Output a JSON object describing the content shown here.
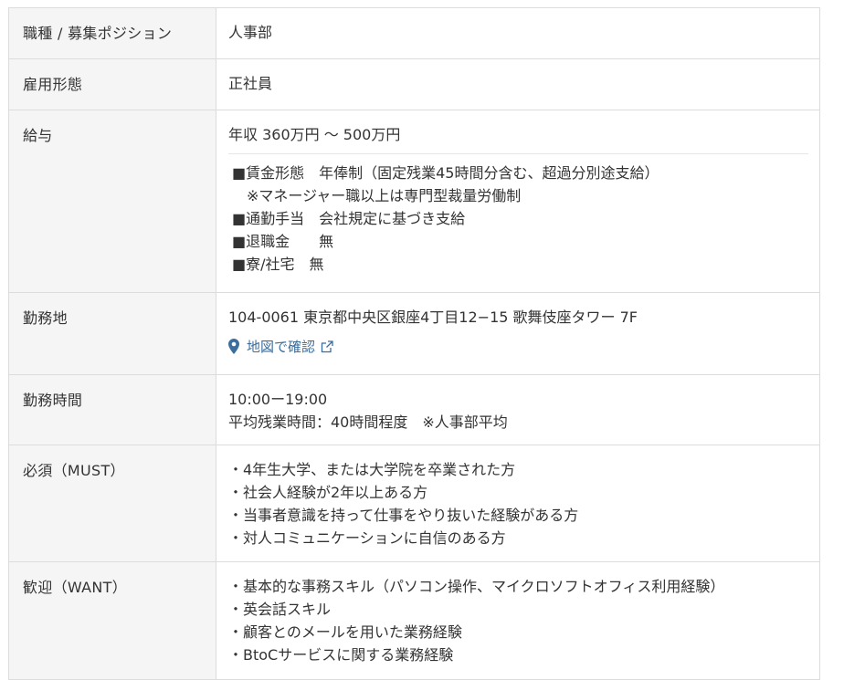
{
  "rows": [
    {
      "label": "職種 / 募集ポジション",
      "lines": [
        "人事部"
      ]
    },
    {
      "label": "雇用形態",
      "lines": [
        "正社員"
      ]
    },
    {
      "label": "給与",
      "lines": [
        "年収 360万円 ～ 500万円"
      ],
      "details": [
        "■賃金形態　年俸制（固定残業45時間分含む、超過分別途支給）",
        "　※マネージャー職以上は専門型裁量労働制",
        "■通勤手当　会社規定に基づき支給",
        "■退職金　　無",
        "■寮/社宅　無"
      ]
    },
    {
      "label": "勤務地",
      "lines": [
        "104-0061 東京都中央区銀座4丁目12−15 歌舞伎座タワー 7F"
      ],
      "map_link": "地図で確認"
    },
    {
      "label": "勤務時間",
      "lines": [
        "10:00ー19:00",
        "平均残業時間：40時間程度　※人事部平均"
      ]
    },
    {
      "label": "必須（MUST）",
      "lines": [
        "・4年生大学、または大学院を卒業された方",
        "・社会人経験が2年以上ある方",
        "・当事者意識を持って仕事をやり抜いた経験がある方",
        "・対人コミュニケーションに自信のある方"
      ]
    },
    {
      "label": "歓迎（WANT）",
      "lines": [
        "・基本的な事務スキル（パソコン操作、マイクロソフトオフィス利用経験）",
        "・英会話スキル",
        "・顧客とのメールを用いた業務経験",
        "・BtoCサービスに関する業務経験"
      ]
    }
  ],
  "icons": {
    "map": "map-pin-icon",
    "external": "external-link-icon"
  },
  "colors": {
    "label_bg": "#f5f5f5",
    "border": "#dcdcdc",
    "link": "#3b6e9e",
    "text": "#333333"
  }
}
